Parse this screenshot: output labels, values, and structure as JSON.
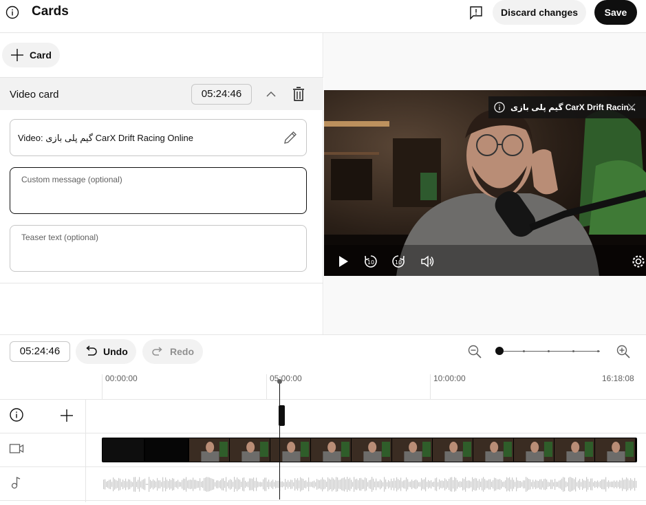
{
  "header": {
    "title": "Cards",
    "discard_label": "Discard changes",
    "save_label": "Save"
  },
  "editor": {
    "add_card_label": "Card",
    "card_type": "Video card",
    "card_time": "05:24:46",
    "video_field_text": "Video: گیم پلی بازی CarX Drift Racing Online",
    "custom_message_placeholder": "Custom message (optional)",
    "teaser_placeholder": "Teaser text (optional)"
  },
  "preview": {
    "teaser_title": "گیم پلی بازی CarX Drift Racin..."
  },
  "timeline": {
    "current_time": "05:24:46",
    "undo_label": "Undo",
    "redo_label": "Redo",
    "ruler": [
      "00:00:00",
      "05:00:00",
      "10:00:00",
      "16:18:08"
    ],
    "zoom_level": 0
  },
  "icons": {
    "info": "info-icon",
    "feedback": "feedback-icon",
    "plus": "plus-icon",
    "collapse": "chevron-up-icon",
    "delete": "trash-icon",
    "edit": "pencil-icon",
    "close": "close-icon",
    "play": "play-icon",
    "rewind": "rewind-10-icon",
    "forward": "forward-10-icon",
    "volume": "volume-icon",
    "settings": "gear-icon",
    "zoom_out": "zoom-out-icon",
    "zoom_in": "zoom-in-icon",
    "video_track": "video-camera-icon",
    "audio_track": "music-note-icon"
  },
  "colors": {
    "primary": "#0f0f0f",
    "chip_bg": "#f2f2f2",
    "border": "#c6c6c6",
    "muted": "#606060"
  }
}
